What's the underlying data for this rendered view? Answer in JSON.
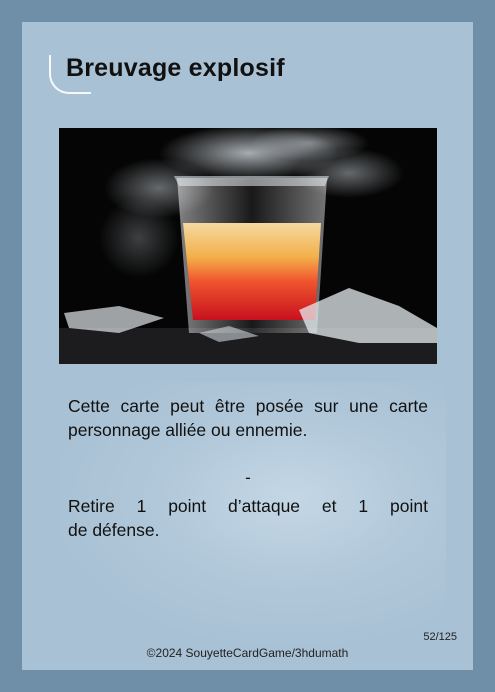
{
  "card": {
    "title": "Breuvage explosif",
    "description": "Cette carte peut être posée sur une carte personnage alliée ou ennemie.",
    "separator": "-",
    "effect_line1": "Retire 1 point d’attaque et 1 point",
    "effect_line2": "de défense.",
    "card_number": "52/125",
    "copyright": "©2024 SouyetteCardGame/3hdumath"
  },
  "colors": {
    "border": "#6f8fa9",
    "card_background": "#a9c1d4",
    "liquid_top": "#f2c46a",
    "liquid_bottom": "#e0222a"
  }
}
